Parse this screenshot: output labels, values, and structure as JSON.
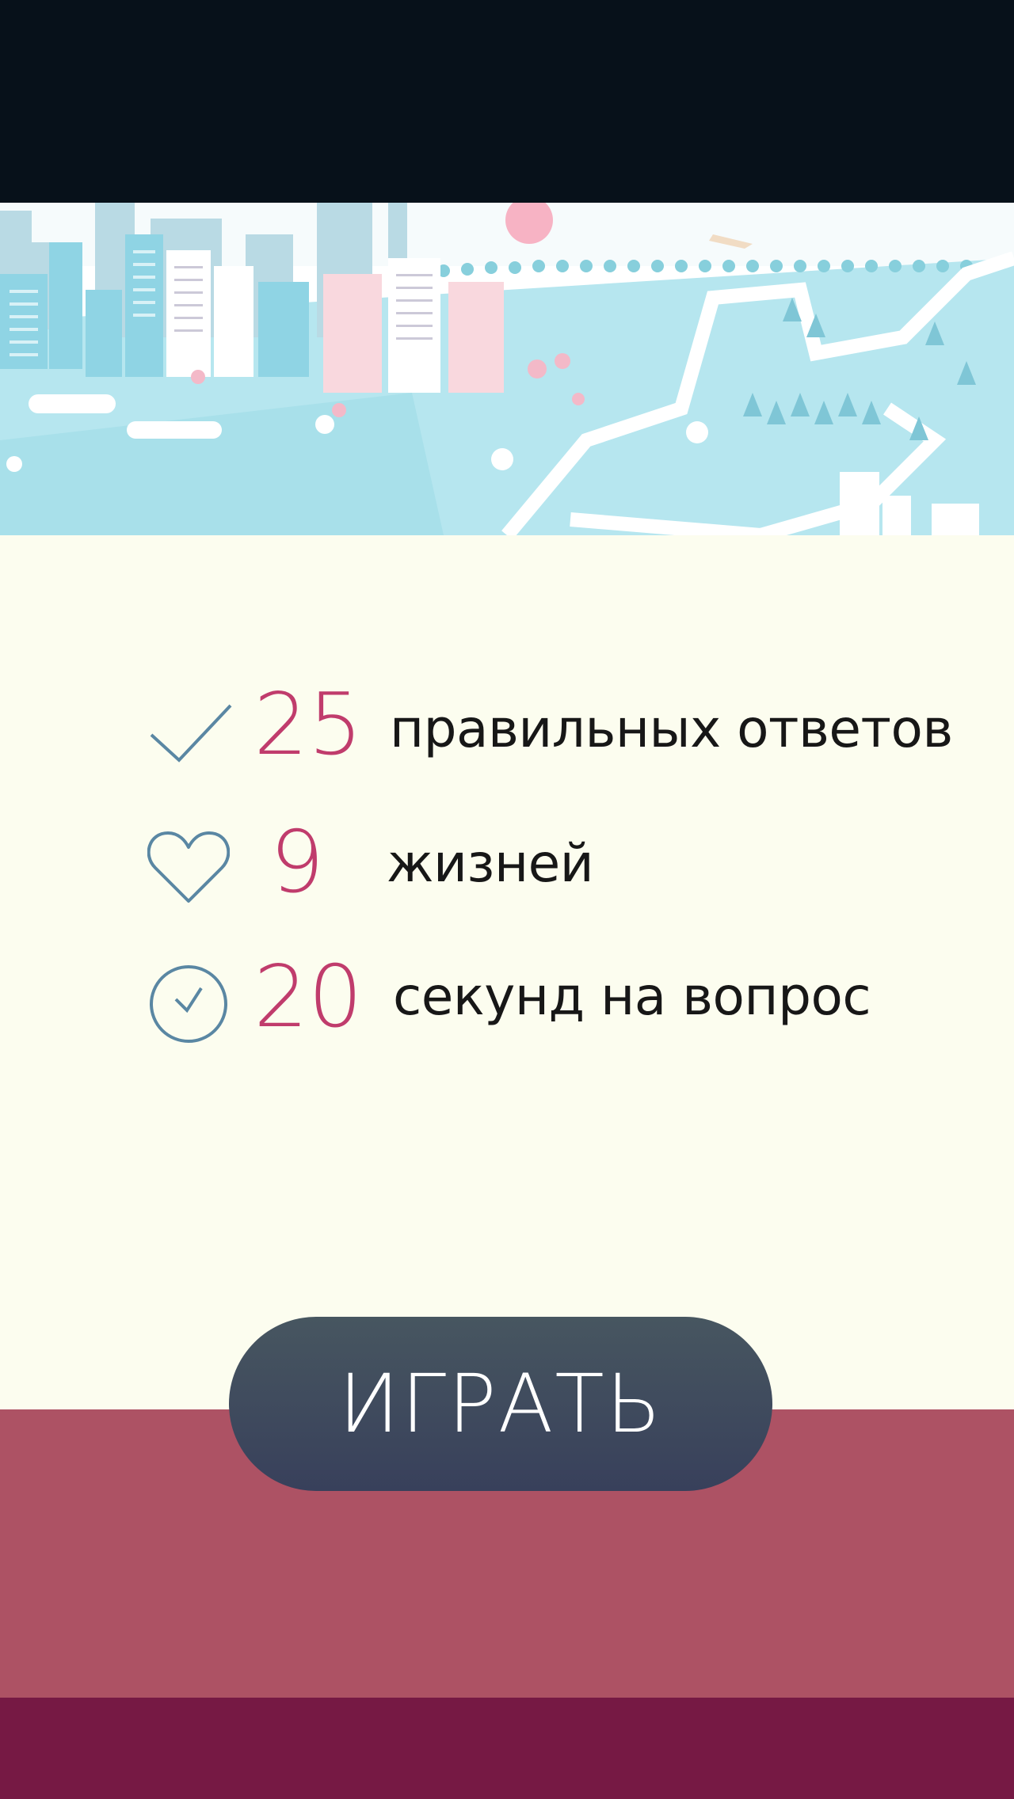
{
  "stats": [
    {
      "icon": "check-icon",
      "value": "25",
      "label": "правильных ответов"
    },
    {
      "icon": "heart-icon",
      "value": "9",
      "label": "жизней"
    },
    {
      "icon": "clock-check-icon",
      "value": "20",
      "label": "секунд на вопрос"
    }
  ],
  "play_button": {
    "label": "ИГРАТЬ"
  },
  "colors": {
    "top_bar": "#07111a",
    "background": "#fcfdef",
    "value_accent": "#c03c6c",
    "icon_stroke": "#5a87a3",
    "bottom_band": "#ad5264",
    "footer_band": "#761944",
    "button_gradient_top": "#475660",
    "button_gradient_bottom": "#38405b"
  }
}
